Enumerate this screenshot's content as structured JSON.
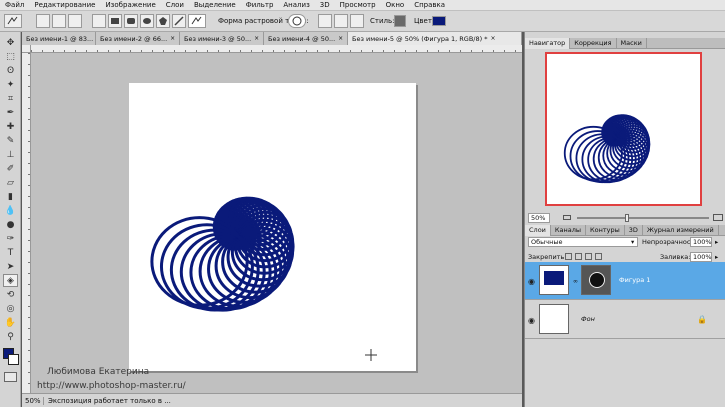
{
  "menu": [
    "Файл",
    "Редактирование",
    "Изображение",
    "Слои",
    "Выделение",
    "Фильтр",
    "Анализ",
    "3D",
    "Просмотр",
    "Окно",
    "Справка"
  ],
  "options": {
    "raster_shape_label": "Форма растровой точки:",
    "style_label": "Стиль:",
    "color_label": "Цвет:",
    "color_value": "#0a1a7a"
  },
  "doc_tabs": [
    {
      "label": "Без имени-1 @ 83...",
      "close": "×"
    },
    {
      "label": "Без имени-2 @ 66...",
      "close": "×"
    },
    {
      "label": "Без имени-3 @ 50...",
      "close": "×"
    },
    {
      "label": "Без имени-4 @ 50...",
      "close": "×"
    },
    {
      "label": "Без имени-5 @ 50% (Фигура 1, RGB/8) *",
      "close": "×"
    }
  ],
  "watermark": {
    "author": "Любимова Екатерина",
    "url": "http://www.photoshop-master.ru/"
  },
  "status": {
    "zoom": "50%",
    "info": "Экспозиция работает только в ..."
  },
  "navigator": {
    "tabs": [
      "Навигатор",
      "Коррекция",
      "Маски"
    ],
    "zoom": "50%"
  },
  "layers_panel": {
    "tabs": [
      "Слои",
      "Каналы",
      "Контуры",
      "3D",
      "Журнал измерений"
    ],
    "blend_mode": "Обычные",
    "opacity_label": "Непрозрачность:",
    "opacity_value": "100%",
    "lock_label": "Закрепить:",
    "fill_label": "Заливка:",
    "fill_value": "100%",
    "layers": [
      {
        "name": "Фигура 1",
        "selected": true
      },
      {
        "name": "Фон",
        "selected": false
      }
    ]
  },
  "shape_color": "#0a1a7a",
  "accent_selected": "#5aa8e6"
}
